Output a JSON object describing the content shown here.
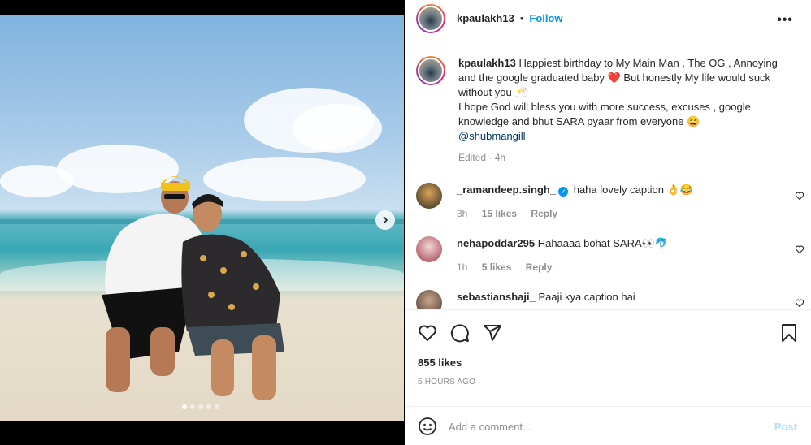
{
  "post": {
    "username": "kpaulakh13",
    "follow_label": "Follow",
    "separator": "•",
    "more_label": "•••",
    "caption": {
      "username": "kpaulakh13",
      "line1": " Happiest birthday to My Main Man , The OG , Annoying and the google graduated baby ",
      "emoji1": "❤️",
      "line2": " But honestly My life would suck without you ",
      "emoji2": "🥂",
      "line3": "I hope God will bless you with more success, excuses , google knowledge and bhut SARA pyaar from everyone ",
      "emoji3": "😄",
      "mention": "@shubmangill",
      "meta": "Edited · 4h"
    },
    "comments": [
      {
        "username": "_ramandeep.singh_",
        "verified": true,
        "text": " haha lovely caption 👌😂",
        "time": "3h",
        "likes": "15 likes",
        "reply": "Reply"
      },
      {
        "username": "nehapoddar295",
        "verified": false,
        "text": " Hahaaaa bohat SARA👀🐬",
        "time": "1h",
        "likes": "5 likes",
        "reply": "Reply"
      },
      {
        "username": "sebastianshaji_",
        "verified": false,
        "text": " Paaji kya caption hai",
        "time": "",
        "likes": "",
        "reply": ""
      }
    ],
    "likes_count": "855 likes",
    "time_ago": "5 HOURS AGO",
    "add_comment_placeholder": "Add a comment...",
    "post_label": "Post"
  },
  "colors": {
    "accent": "#0095f6",
    "mention": "#00376b",
    "muted": "#8e8e8e",
    "post_disabled": "#b2dffc"
  },
  "carousel": {
    "slide_count": 5,
    "active_slide": 1
  }
}
